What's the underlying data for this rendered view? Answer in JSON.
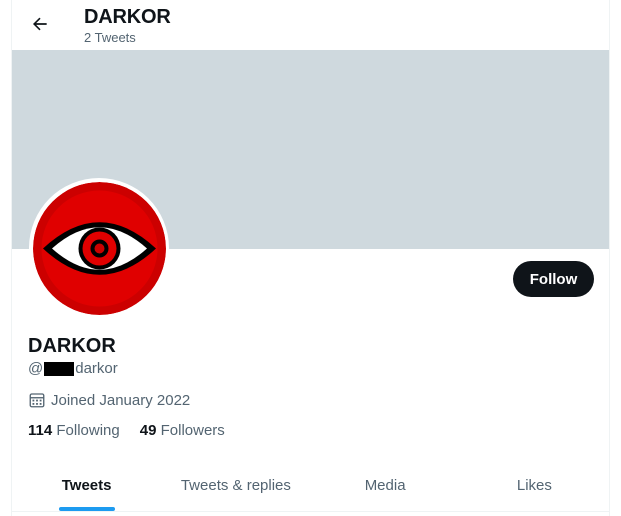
{
  "header": {
    "title": "DARKOR",
    "tweet_count": "2 Tweets",
    "back_icon": "arrow-left-icon"
  },
  "banner": {
    "color": "#cfd9de"
  },
  "profile": {
    "display_name": "DARKOR",
    "handle_prefix": "@",
    "handle_suffix": "darkor",
    "joined": "Joined January 2022",
    "following_count": "114",
    "following_label": "Following",
    "followers_count": "49",
    "followers_label": "Followers"
  },
  "actions": {
    "follow_label": "Follow"
  },
  "tabs": [
    {
      "label": "Tweets",
      "active": true
    },
    {
      "label": "Tweets & replies",
      "active": false
    },
    {
      "label": "Media",
      "active": false
    },
    {
      "label": "Likes",
      "active": false
    }
  ],
  "colors": {
    "accent": "#1d9bf0",
    "text": "#0f1419",
    "muted": "#536471"
  }
}
